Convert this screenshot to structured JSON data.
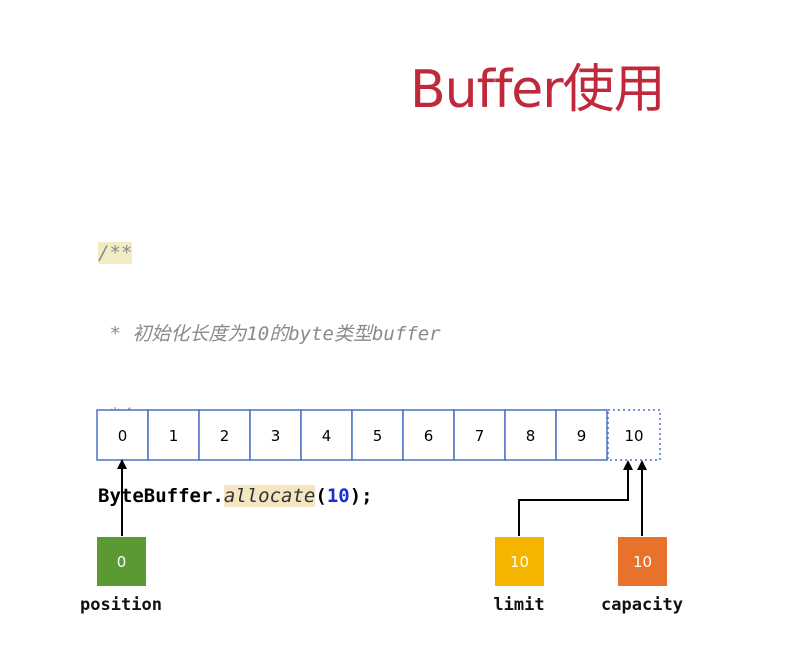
{
  "title": "Buffer使用",
  "code": {
    "line1_comment_open": "/**",
    "line2_comment": " * 初始化长度为10的byte类型buffer",
    "line3_comment_close": " */",
    "line4_class": "ByteBuffer",
    "line4_dot": ".",
    "line4_method": "allocate",
    "line4_open": "(",
    "line4_arg": "10",
    "line4_close": ");"
  },
  "diagram": {
    "cells": [
      "0",
      "1",
      "2",
      "3",
      "4",
      "5",
      "6",
      "7",
      "8",
      "9"
    ],
    "extra_cell": "10",
    "markers": [
      {
        "label": "position",
        "value": "0",
        "color": "#5b9a33"
      },
      {
        "label": "limit",
        "value": "10",
        "color": "#f5b400"
      },
      {
        "label": "capacity",
        "value": "10",
        "color": "#e8722c"
      }
    ],
    "cell_border_color": "#4a72c4"
  }
}
